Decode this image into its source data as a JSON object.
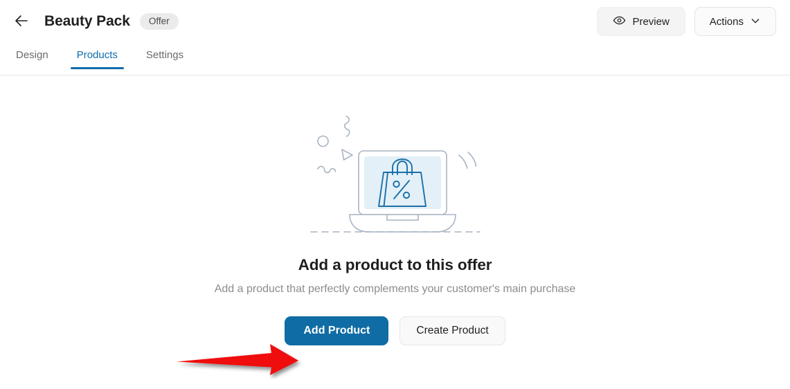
{
  "header": {
    "back_icon": "arrow-left-icon",
    "title": "Beauty Pack",
    "badge": "Offer",
    "preview_label": "Preview",
    "preview_icon": "eye-icon",
    "actions_label": "Actions",
    "actions_icon": "chevron-down-icon"
  },
  "tabs": [
    {
      "label": "Design",
      "active": false
    },
    {
      "label": "Products",
      "active": true
    },
    {
      "label": "Settings",
      "active": false
    }
  ],
  "empty_state": {
    "illustration_name": "laptop-shopping-bag-discount-illustration",
    "title": "Add a product to this offer",
    "subtitle": "Add a product that perfectly complements your customer's main purchase",
    "primary_button": "Add Product",
    "secondary_button": "Create Product"
  },
  "annotation": {
    "arrow_name": "red-pointer-arrow",
    "arrow_color": "#ef1111",
    "points_to": "Add Product"
  },
  "colors": {
    "accent_blue": "#0f6cab",
    "primary_button": "#0f6ca4",
    "badge_bg": "#ebebeb",
    "illustration_outline": "#a8b4c2",
    "illustration_screen": "#e3f0f8",
    "illustration_bag": "#1b6fa8",
    "muted_text": "#8c8c8c"
  }
}
